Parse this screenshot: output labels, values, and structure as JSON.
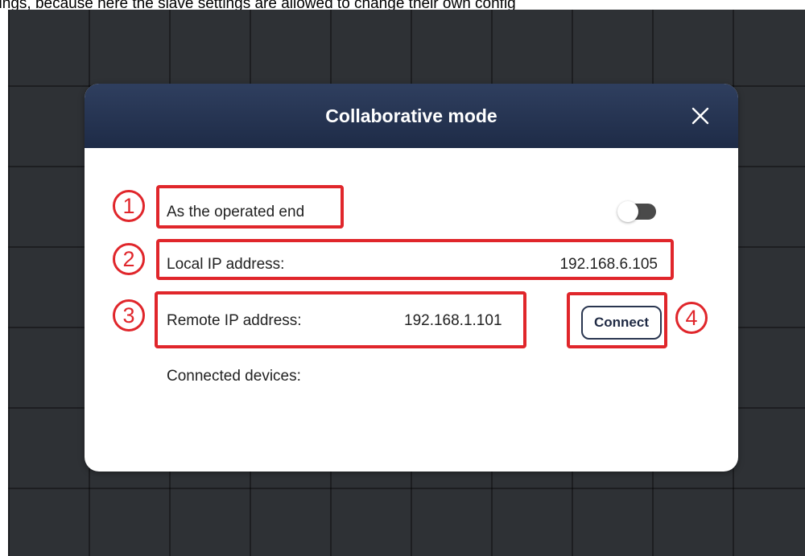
{
  "caption": {
    "text": "ttings, because here the slave settings are allowed to change their own config"
  },
  "dialog": {
    "title": "Collaborative mode",
    "close_icon": "close-icon",
    "operated_end": {
      "label": "As the operated end",
      "toggle_state": "off"
    },
    "local_ip": {
      "label": "Local IP address:",
      "value": "192.168.6.105"
    },
    "remote_ip": {
      "label": "Remote IP address:",
      "value": "192.168.1.101"
    },
    "connect_button": "Connect",
    "connected_devices": {
      "label": "Connected devices:"
    }
  },
  "annotations": {
    "markers": [
      "1",
      "2",
      "3",
      "4"
    ],
    "color": "#e0262b"
  },
  "colors": {
    "header": "#1e2b47",
    "background": "#2e3135",
    "highlight": "#e0262b"
  }
}
